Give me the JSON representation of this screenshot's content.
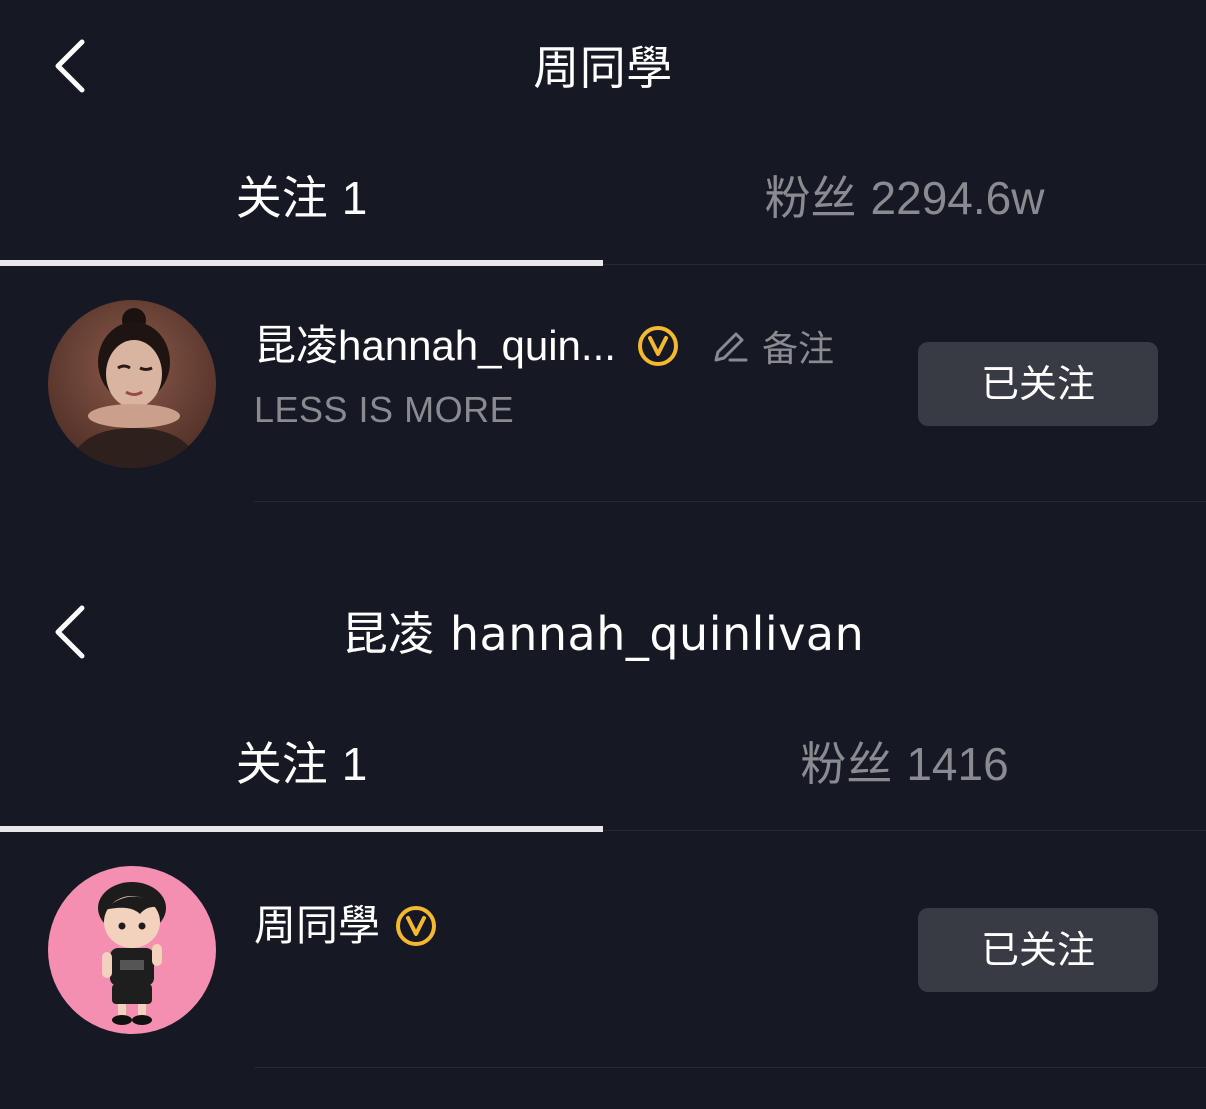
{
  "screens": [
    {
      "header": {
        "title": "周同學"
      },
      "tabs": {
        "following_label": "关注",
        "following_count": "1",
        "followers_label": "粉丝",
        "followers_count": "2294.6w"
      },
      "user": {
        "name": "昆凌hannah_quin...",
        "bio": "LESS IS MORE",
        "remark_label": "备注",
        "follow_button": "已关注",
        "verified_color": "#f5b82e"
      }
    },
    {
      "header": {
        "title": "昆凌 hannah_quinlivan"
      },
      "tabs": {
        "following_label": "关注",
        "following_count": "1",
        "followers_label": "粉丝",
        "followers_count": "1416"
      },
      "user": {
        "name": "周同學",
        "follow_button": "已关注",
        "verified_color": "#f5b82e"
      }
    }
  ]
}
